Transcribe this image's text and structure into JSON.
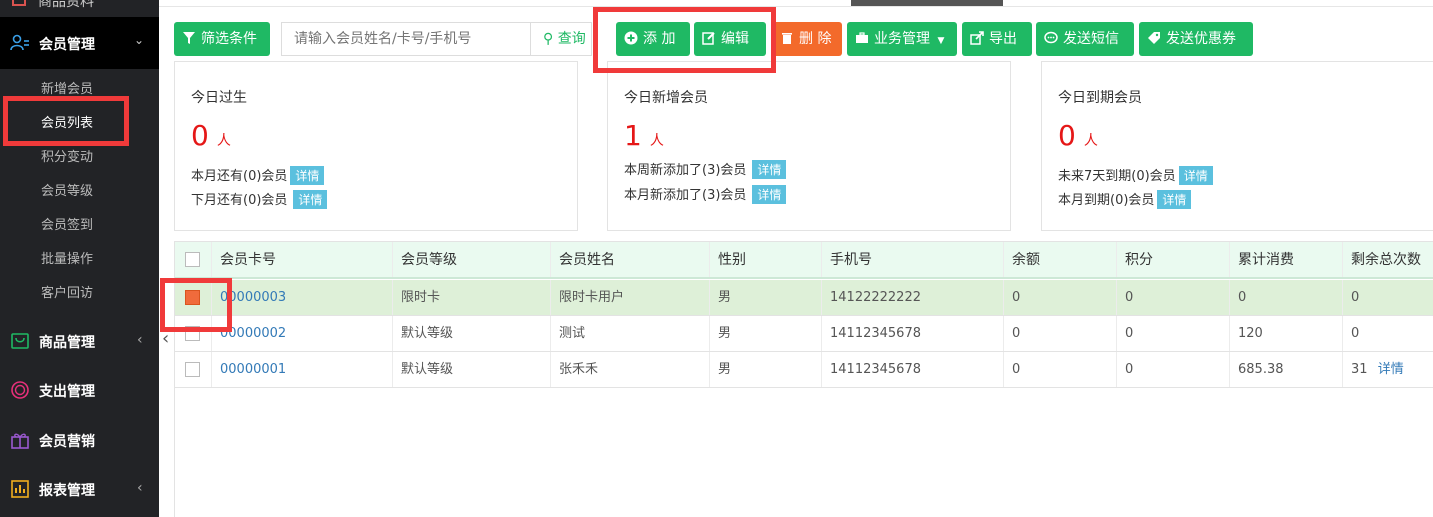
{
  "sidebar": {
    "top_cut_label": "商品资料",
    "member_mgmt": {
      "label": "会员管理",
      "chevron": "⌄"
    },
    "sub_items": [
      "新增会员",
      "会员列表",
      "积分变动",
      "会员等级",
      "会员签到",
      "批量操作",
      "客户回访"
    ],
    "groups": [
      {
        "label": "商品管理",
        "chevron": "‹",
        "icon": "cart-icon"
      },
      {
        "label": "支出管理",
        "chevron": "",
        "icon": "coin-icon"
      },
      {
        "label": "会员营销",
        "chevron": "",
        "icon": "gift-icon"
      },
      {
        "label": "报表管理",
        "chevron": "‹",
        "icon": "chart-icon"
      }
    ]
  },
  "toolbar": {
    "filter_label": "筛选条件",
    "search_placeholder": "请输入会员姓名/卡号/手机号",
    "search_label": "查询",
    "add_label": "添 加",
    "edit_label": "编辑",
    "delete_label": "删 除",
    "business_label": "业务管理",
    "export_label": "导出",
    "sms_label": "发送短信",
    "coupon_label": "发送优惠券"
  },
  "stats": {
    "birthday": {
      "title": "今日过生",
      "count": "0",
      "unit": "人",
      "line1": "本月还有(0)会员",
      "line2": "下月还有(0)会员",
      "detail": "详情"
    },
    "new_members": {
      "title": "今日新增会员",
      "count": "1",
      "unit": "人",
      "line1": "本周新添加了(3)会员",
      "line2": "本月新添加了(3)会员",
      "detail": "详情"
    },
    "expiring": {
      "title": "今日到期会员",
      "count": "0",
      "unit": "人",
      "line1": "未来7天到期(0)会员",
      "line2": "本月到期(0)会员",
      "detail": "详情"
    }
  },
  "table": {
    "headers": [
      "会员卡号",
      "会员等级",
      "会员姓名",
      "性别",
      "手机号",
      "余额",
      "积分",
      "累计消费",
      "剩余总次数"
    ],
    "rows": [
      [
        "00000003",
        "限时卡",
        "限时卡用户",
        "男",
        "14122222222",
        "0",
        "0",
        "0",
        "0"
      ],
      [
        "00000002",
        "默认等级",
        "测试",
        "男",
        "14112345678",
        "0",
        "0",
        "120",
        "0"
      ],
      [
        "00000001",
        "默认等级",
        "张禾禾",
        "男",
        "14112345678",
        "0",
        "0",
        "685.38",
        "31"
      ]
    ],
    "detail_link": "详情"
  },
  "colors": {
    "accent": "#1fb964",
    "danger": "#f36a2b",
    "highlight": "#f03a3a",
    "sidebar": "#222326"
  }
}
